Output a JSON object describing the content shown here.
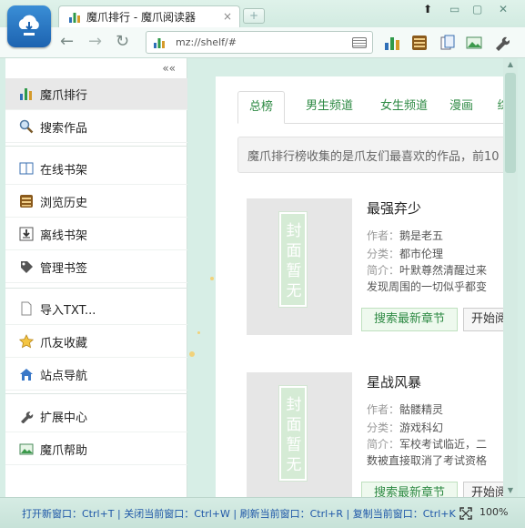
{
  "window": {
    "tab_title": "魔爪排行 - 魔爪阅读器",
    "tab_close": "×",
    "new_tab": "+",
    "controls": [
      "⬆",
      "▭",
      "▢",
      "✕"
    ]
  },
  "toolbar": {
    "back": "←",
    "forward": "→",
    "refresh": "↻",
    "address": "mz://shelf/#",
    "icons": [
      "ranking-icon",
      "reader-icon",
      "docs-icon",
      "image-icon",
      "wrench-icon"
    ]
  },
  "sidebar": {
    "collapse": "««",
    "items": [
      {
        "label": "魔爪排行",
        "icon": "ranking-icon",
        "active": true
      },
      {
        "label": "搜索作品",
        "icon": "search-icon"
      },
      {
        "label": "在线书架",
        "icon": "bookshelf-icon"
      },
      {
        "label": "浏览历史",
        "icon": "history-icon"
      },
      {
        "label": "离线书架",
        "icon": "download-icon"
      },
      {
        "label": "管理书签",
        "icon": "bookmark-icon"
      },
      {
        "label": "导入TXT...",
        "icon": "document-icon"
      },
      {
        "label": "爪友收藏",
        "icon": "star-icon"
      },
      {
        "label": "站点导航",
        "icon": "home-icon"
      },
      {
        "label": "扩展中心",
        "icon": "wrench-icon"
      },
      {
        "label": "魔爪帮助",
        "icon": "help-icon"
      }
    ]
  },
  "content": {
    "tabs": [
      "总榜",
      "男生频道",
      "女生频道",
      "漫画",
      "综"
    ],
    "notice": "魔爪排行榜收集的是爪友们最喜欢的作品，前10",
    "cover_text": "封面暂无",
    "author_label": "作者：",
    "category_label": "分类：",
    "summary_label": "简介：",
    "search_btn": "搜索最新章节",
    "read_btn": "开始阅读",
    "books": [
      {
        "title": "最强弃少",
        "author": "鹅是老五",
        "category": "都市伦理",
        "summary": "叶默尊然清醒过来",
        "summary2": "发现周围的一切似乎都变"
      },
      {
        "title": "星战风暴",
        "author": "骷髅精灵",
        "category": "游戏科幻",
        "summary": "军校考试临近，二",
        "summary2": "数被直接取消了考试资格"
      }
    ]
  },
  "statusbar": {
    "text": "打开新窗口：Ctrl+T | 关闭当前窗口：Ctrl+W | 刷新当前窗口：Ctrl+R | 复制当前窗口：Ctrl+K",
    "zoom": "100%"
  },
  "colors": {
    "accent_green": "#2e8a44",
    "status_blue": "#1f58a8",
    "background": "#d7eee6"
  }
}
